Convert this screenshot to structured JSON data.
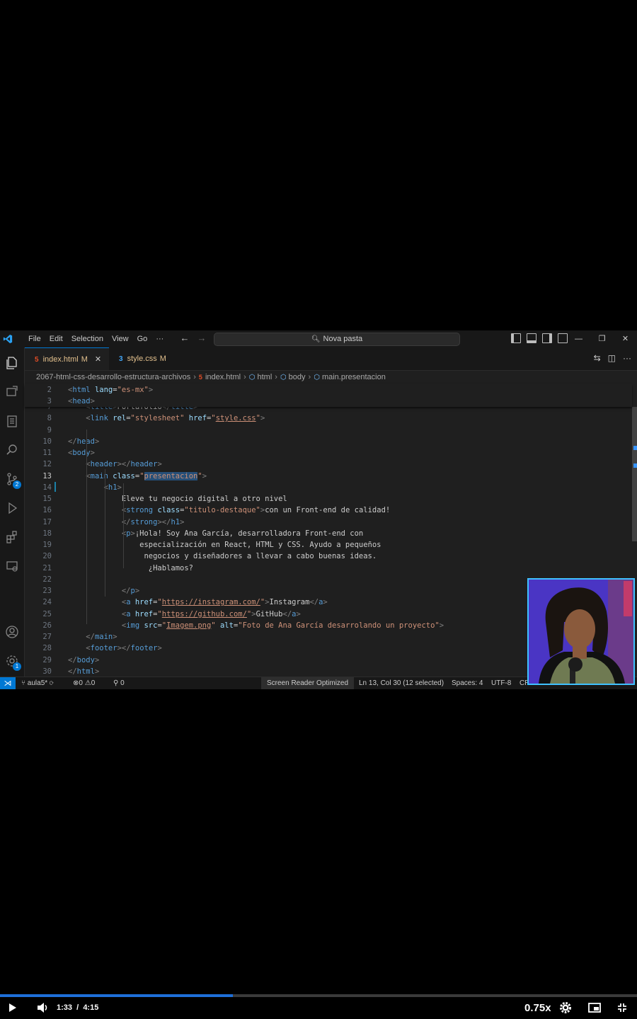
{
  "menu": [
    "File",
    "Edit",
    "Selection",
    "View",
    "Go",
    "···"
  ],
  "search": {
    "label": "Nova pasta"
  },
  "tabs": [
    {
      "label": "index.html",
      "status": "M",
      "icon": "html5-icon"
    },
    {
      "label": "style.css",
      "status": "M",
      "icon": "css3-icon"
    }
  ],
  "breadcrumb": {
    "folder": "2067-html-css-desarrollo-estructura-archivos",
    "file": "index.html",
    "path": [
      "html",
      "body",
      "main.presentacion"
    ]
  },
  "activity_badges": {
    "source_control": "2",
    "settings": "1"
  },
  "code": {
    "sticky": [
      {
        "n": "2",
        "t": "<html lang=\"es-mx\">"
      },
      {
        "n": "3",
        "t": "<head>"
      }
    ],
    "lines": [
      {
        "n": "7",
        "t": "<title>Portafolio</title>"
      },
      {
        "n": "8",
        "t": "<link rel=\"stylesheet\" href=\"style.css\">"
      },
      {
        "n": "9",
        "t": ""
      },
      {
        "n": "10",
        "t": "</head>"
      },
      {
        "n": "11",
        "t": "<body>"
      },
      {
        "n": "12",
        "t": "<header></header>"
      },
      {
        "n": "13",
        "t": "<main class=\"presentacion\">"
      },
      {
        "n": "14",
        "t": "<h1>"
      },
      {
        "n": "15",
        "t": "Eleve tu negocio digital a otro nivel"
      },
      {
        "n": "16",
        "t": "<strong class=\"titulo-destaque\">con un Front-end de calidad!"
      },
      {
        "n": "17",
        "t": "</strong></h1>"
      },
      {
        "n": "18",
        "t": "<p>¡Hola! Soy Ana García, desarrolladora Front-end con"
      },
      {
        "n": "19",
        "t": "especialización en React, HTML y CSS. Ayudo a pequeños"
      },
      {
        "n": "20",
        "t": "negocios y diseñadores a llevar a cabo buenas ideas."
      },
      {
        "n": "21",
        "t": "¿Hablamos?"
      },
      {
        "n": "22",
        "t": ""
      },
      {
        "n": "23",
        "t": "</p>"
      },
      {
        "n": "24",
        "t": "<a href=\"https://instagram.com/\">Instagram</a>"
      },
      {
        "n": "25",
        "t": "<a href=\"https://github.com/\">GitHub</a>"
      },
      {
        "n": "26",
        "t": "<img src=\"Imagem.png\" alt=\"Foto de Ana García desarrolando un proyecto\">"
      },
      {
        "n": "27",
        "t": "</main>"
      },
      {
        "n": "28",
        "t": "<footer></footer>"
      },
      {
        "n": "29",
        "t": "</body>"
      },
      {
        "n": "30",
        "t": "</html>"
      }
    ]
  },
  "statusbar": {
    "branch": "aula5*",
    "errors": "0",
    "warnings": "0",
    "ports": "0",
    "screen_reader": "Screen Reader Optimized",
    "cursor": "Ln 13, Col 30 (12 selected)",
    "spaces": "Spaces: 4",
    "encoding": "UTF-8",
    "eol": "CR"
  },
  "player": {
    "current_time": "1:33",
    "duration": "4:15",
    "progress": 0.365,
    "speed": "0.75x"
  },
  "colors": {
    "accent": "#0078d4",
    "progress": "#1e6fd9",
    "webcam_border": "#3fc1ff"
  }
}
